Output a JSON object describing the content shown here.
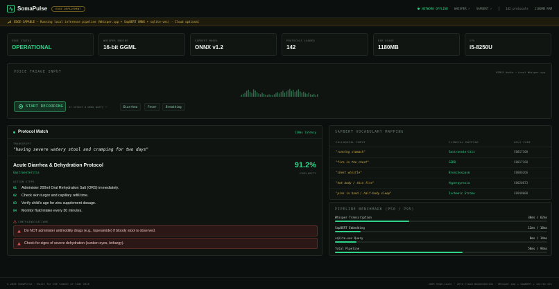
{
  "header": {
    "brand": "SomaPulse",
    "badge": "EDGE DEPLOYMENT",
    "network": "NETWORK OFFLINE",
    "model1": "WHISPER ✓",
    "model2": "SAPBERT ✓",
    "protocols": "142 protocols",
    "memory": "1180MB RAM"
  },
  "banner": {
    "text": "EDGE-CAPABLE — Running local inference pipeline (Whisper.cpp + SapBERT ONNX + sqlite-vec) · Cloud optional"
  },
  "stats": [
    {
      "label": "EDGE STATUS",
      "value": "OPERATIONAL"
    },
    {
      "label": "WHISPER ENGINE",
      "value": "16-bit GGML"
    },
    {
      "label": "SAPBERT MODEL",
      "value": "ONNX v1.2"
    },
    {
      "label": "PROTOCOLS LOADED",
      "value": "142"
    },
    {
      "label": "RAM USAGE",
      "value": "1180MB"
    },
    {
      "label": "CPU",
      "value": "i5-8250U"
    }
  ],
  "voice": {
    "title": "VOICE TRIAGE INPUT",
    "note": "HTML5 Audio → Local Whisper.cpp",
    "record_label": "START RECORDING",
    "demo_hint": "or select a demo query →",
    "demo_chips": [
      "Diarrhea",
      "Fever",
      "Breathing"
    ],
    "waveform_levels": [
      0.25,
      0.35,
      0.5,
      0.7,
      0.85,
      0.6,
      0.45,
      0.9,
      0.75,
      0.55,
      0.4,
      0.3,
      0.5,
      0.35,
      0.25,
      0.2,
      0.3,
      0.25,
      0.2,
      0.3,
      0.45,
      0.55,
      0.4,
      0.6,
      0.75,
      0.5,
      0.65,
      0.8,
      0.95,
      0.7,
      0.85,
      0.6,
      0.75,
      0.9,
      0.65,
      0.5,
      0.6,
      0.45,
      0.35,
      0.5,
      0.3,
      0.25,
      0.35,
      0.2,
      0.3
    ]
  },
  "protocol": {
    "title": "Protocol Match",
    "latency": "118ms latency",
    "transcript_label": "TRANSCRIPT",
    "transcript": "\"having severe watery stool and cramping for two days\"",
    "name": "Acute Diarrhea & Dehydration Protocol",
    "category": "Gastroenteritis",
    "similarity": "91.2%",
    "similarity_label": "SIMILARITY",
    "steps_label": "ACTION STEPS",
    "steps": [
      {
        "num": "01",
        "text": "Administer 200ml Oral Rehydration Salt (ORS) immediately."
      },
      {
        "num": "02",
        "text": "Check skin turgor and capillary refill time."
      },
      {
        "num": "03",
        "text": "Verify child's age for zinc supplement dosage."
      },
      {
        "num": "04",
        "text": "Monitor fluid intake every 30 minutes."
      }
    ],
    "contra_label": "CONTRAINDICATIONS",
    "contraindications": [
      "Do NOT administer antimotility drugs (e.g., loperamide) if bloody stool is observed.",
      "Check for signs of severe dehydration (sunken eyes, lethargy)."
    ]
  },
  "vocab": {
    "title": "SAPBERT VOCABULARY MAPPING",
    "headers": [
      "COLLOQUIAL INPUT",
      "CLINICAL MAPPING",
      "UMLS CODE"
    ],
    "rows": [
      {
        "input": "\"running stomach\"",
        "mapping": "Gastroenteritis",
        "code": "C0017160"
      },
      {
        "input": "\"fire in the chest\"",
        "mapping": "GERD",
        "code": "C0017168"
      },
      {
        "input": "\"chest whistle\"",
        "mapping": "Bronchospasm",
        "code": "C0006266"
      },
      {
        "input": "\"hot body / skin fire\"",
        "mapping": "Hyperpyrexia",
        "code": "C0020673"
      },
      {
        "input": "\"pins in hand / half-body sleep\"",
        "mapping": "Ischemic Stroke",
        "code": "C0948008"
      }
    ]
  },
  "bench": {
    "title": "PIPELINE BENCHMARK (P50 / P95)",
    "rows": [
      {
        "label": "Whisper Transcription",
        "value": "38ms / 62ms",
        "fill": 0.35
      },
      {
        "label": "SapBERT Embedding",
        "value": "12ms / 18ms",
        "fill": 0.12
      },
      {
        "label": "sqlite-vec Query",
        "value": "8ms / 14ms",
        "fill": 0.1
      },
      {
        "label": "Total Pipeline",
        "value": "58ms / 94ms",
        "fill": 0.6
      }
    ]
  },
  "footer": {
    "left": "© 2026 SomaPulse · Built for USE Summit of Code 2026",
    "right": "100% Edge-Local · Zero Cloud Dependencies · Whisper.cpp + SapBERT + sqlite-vec"
  },
  "colors": {
    "accent": "#2fd48a",
    "warning": "#d6b44a",
    "danger": "#5a2a26",
    "background": "#0b0f0d"
  }
}
